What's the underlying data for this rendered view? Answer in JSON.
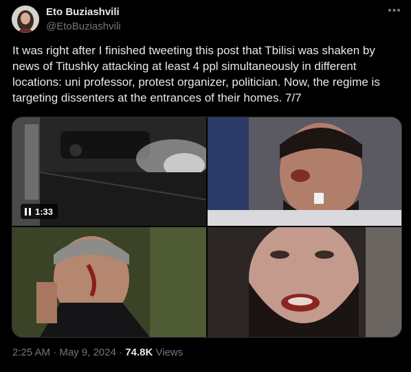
{
  "tweet": {
    "author_name": "Eto Buziashvili",
    "author_handle": "@EtoBuziashvili",
    "more_icon": "more-horizontal-icon",
    "text": "It was right after I finished tweeting this post that Tbilisi was shaken by news of Titushky attacking at least 4 ppl simultaneously in different locations: uni professor, protest organizer, politician. Now, the regime is targeting dissenters at the entrances of their homes. 7/7",
    "media": {
      "video_duration": "1:33"
    },
    "timestamp_time": "2:25 AM",
    "separator": "·",
    "timestamp_date": "May 9, 2024",
    "views_count": "74.8K",
    "views_label": "Views"
  }
}
